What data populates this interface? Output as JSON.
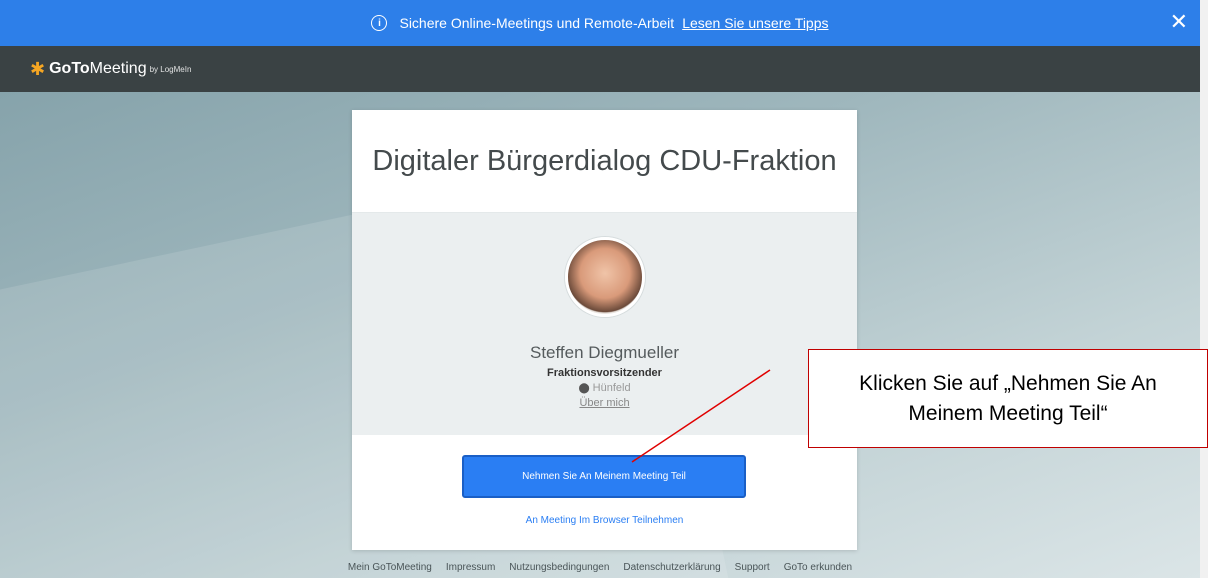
{
  "banner": {
    "text": "Sichere Online-Meetings und Remote-Arbeit",
    "link": "Lesen Sie unsere Tipps",
    "close": "✕"
  },
  "header": {
    "logo_goto": "GoTo",
    "logo_meeting": "Meeting",
    "logo_by": "by LogMeIn"
  },
  "meeting": {
    "title": "Digitaler Bürgerdialog CDU-Fraktion",
    "organizer_name": "Steffen Diegmueller",
    "organizer_role": "Fraktionsvorsitzender",
    "organizer_location": "Hünfeld",
    "about_link": "Über mich",
    "join_button": "Nehmen Sie An Meinem Meeting Teil",
    "browser_link": "An Meeting Im Browser Teilnehmen"
  },
  "footer": {
    "links": [
      "Mein GoToMeeting",
      "Impressum",
      "Nutzungsbedingungen",
      "Datenschutzerklärung",
      "Support",
      "GoTo erkunden"
    ]
  },
  "callout": {
    "text": "Klicken Sie auf „Nehmen Sie An Meinem Meeting Teil“"
  },
  "colors": {
    "banner": "#2d7fe9",
    "topbar": "#3a4244",
    "button": "#2a7ef3",
    "callout_border": "#c00000"
  }
}
